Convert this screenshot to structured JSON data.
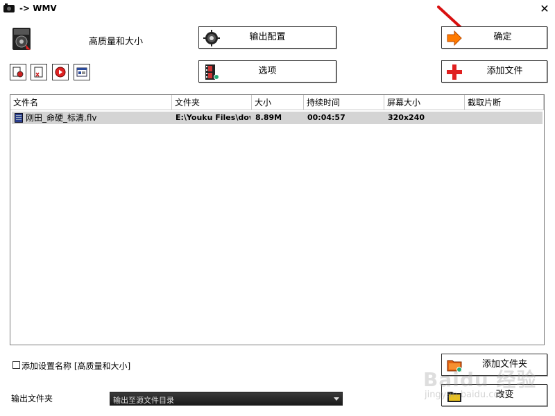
{
  "window": {
    "title": "-> WMV"
  },
  "profile": {
    "label": "高质量和大小"
  },
  "buttons": {
    "output_settings": "输出配置",
    "options": "选项",
    "ok": "确定",
    "add_file": "添加文件",
    "add_folder": "添加文件夹",
    "change": "改变"
  },
  "file_list": {
    "columns": [
      "文件名",
      "文件夹",
      "大小",
      "持续时间",
      "屏幕大小",
      "截取片断"
    ],
    "rows": [
      {
        "name": "刚田_命硬_标清.flv",
        "folder": "E:\\Youku Files\\dow...",
        "size": "8.89M",
        "duration": "00:04:57",
        "screen": "320x240",
        "clip": ""
      }
    ]
  },
  "bottom": {
    "checkbox_label": "添加设置名称 [高质量和大小]",
    "checkbox_checked": false,
    "output_folder_label": "输出文件夹",
    "output_folder_value": "输出至源文件目录"
  },
  "watermark": {
    "text": "Baidu 经验",
    "sub": "jingyan.baidu.com"
  },
  "colors": {
    "selected_row": "#d4d4d4",
    "accent_red": "#e02020",
    "arrow_orange": "#ff7a00"
  }
}
